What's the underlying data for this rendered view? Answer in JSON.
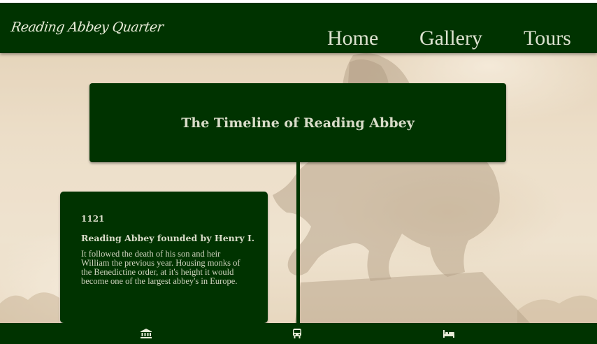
{
  "header": {
    "brand": "Reading Abbey Quarter",
    "nav": [
      {
        "label": "Home"
      },
      {
        "label": "Gallery"
      },
      {
        "label": "Tours"
      }
    ]
  },
  "timeline": {
    "title": "The Timeline of Reading Abbey",
    "events": [
      {
        "year": "1121",
        "title": "Reading Abbey founded by Henry I.",
        "description": "It followed the death of his son and heir William the previous year. Housing monks of the Benedictine order, at it's height it would become one of the largest abbey's in Europe."
      }
    ]
  },
  "footer": {
    "icons": [
      "museum-icon",
      "bus-icon",
      "bed-icon"
    ]
  },
  "colors": {
    "primary_green": "#003300",
    "text_light": "#d8dcc8",
    "background_sepia": "#e6d6bd"
  }
}
